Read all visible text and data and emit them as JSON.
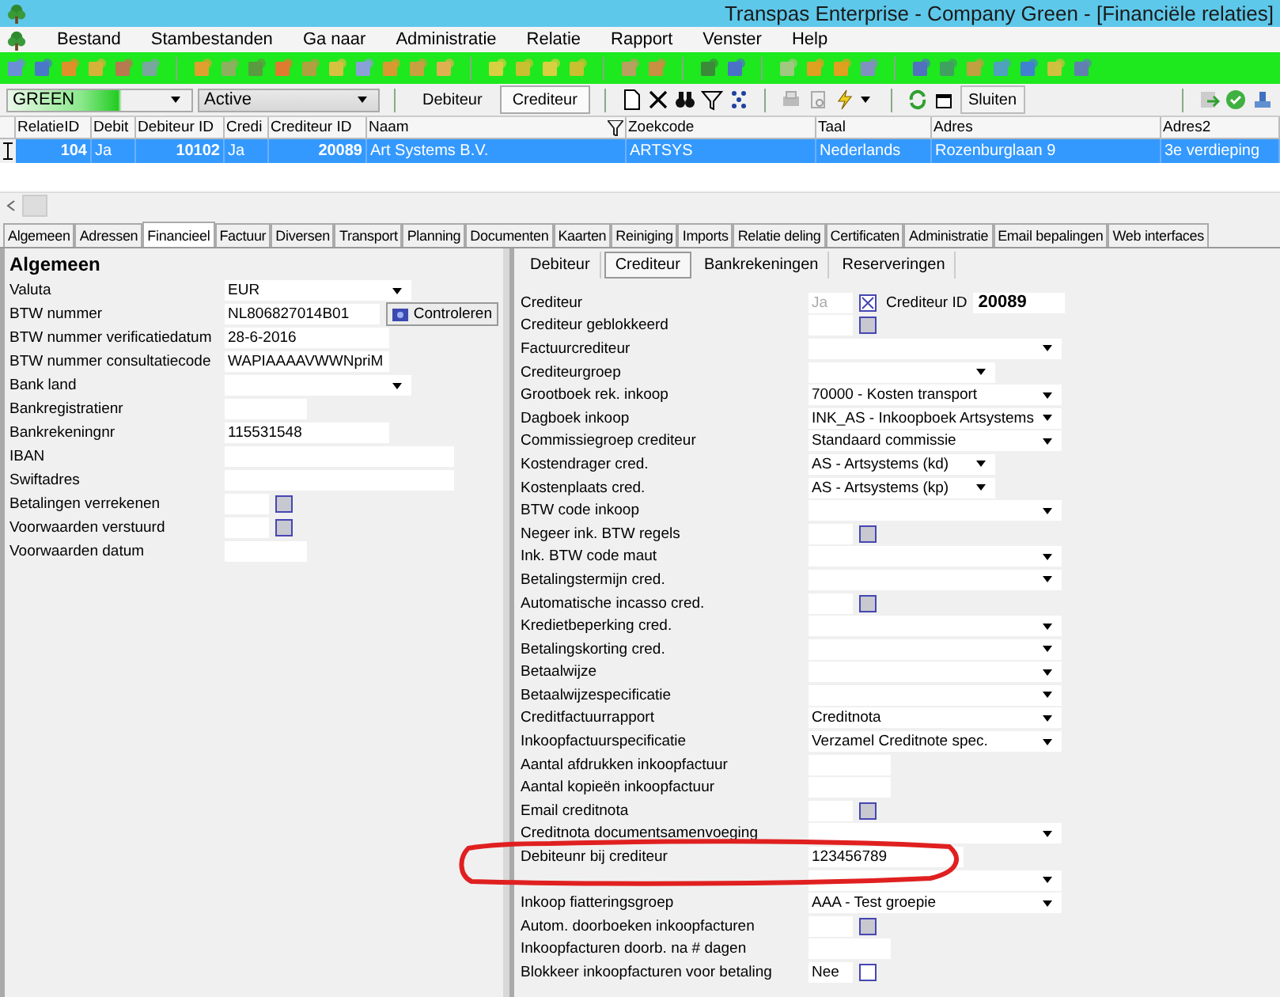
{
  "window": {
    "title": "Transpas Enterprise - Company Green - [Financiële relaties]"
  },
  "menu": [
    "Bestand",
    "Stambestanden",
    "Ga naar",
    "Administratie",
    "Relatie",
    "Rapport",
    "Venster",
    "Help"
  ],
  "filter_bar": {
    "company": "GREEN",
    "status": "Active",
    "modes": [
      {
        "label": "Debiteur",
        "selected": false
      },
      {
        "label": "Crediteur",
        "selected": true
      }
    ],
    "close_button": "Sluiten"
  },
  "grid": {
    "columns": [
      {
        "label": "RelatieID",
        "kind": "number",
        "filtered": false
      },
      {
        "label": "Debit",
        "kind": "text",
        "filtered": false
      },
      {
        "label": "Debiteur ID",
        "kind": "number",
        "filtered": false
      },
      {
        "label": "Credi",
        "kind": "text",
        "filtered": false
      },
      {
        "label": "Crediteur ID",
        "kind": "number",
        "filtered": false
      },
      {
        "label": "Naam",
        "kind": "text",
        "filtered": true
      },
      {
        "label": "Zoekcode",
        "kind": "text",
        "filtered": false
      },
      {
        "label": "Taal",
        "kind": "text",
        "filtered": false
      },
      {
        "label": "Adres",
        "kind": "text",
        "filtered": false
      },
      {
        "label": "Adres2",
        "kind": "text",
        "filtered": false
      }
    ],
    "rows": [
      {
        "selected": true,
        "cells": [
          "104",
          "Ja",
          "10102",
          "Ja",
          "20089",
          "Art Systems B.V.",
          "ARTSYS",
          "Nederlands",
          "Rozenburglaan 9",
          "3e verdieping"
        ]
      }
    ]
  },
  "tabs": [
    {
      "label": "Algemeen",
      "selected": false
    },
    {
      "label": "Adressen",
      "selected": false
    },
    {
      "label": "Financieel",
      "selected": true
    },
    {
      "label": "Factuur",
      "selected": false
    },
    {
      "label": "Diversen",
      "selected": false
    },
    {
      "label": "Transport",
      "selected": false
    },
    {
      "label": "Planning",
      "selected": false
    },
    {
      "label": "Documenten",
      "selected": false
    },
    {
      "label": "Kaarten",
      "selected": false
    },
    {
      "label": "Reiniging",
      "selected": false
    },
    {
      "label": "Imports",
      "selected": false
    },
    {
      "label": "Relatie deling",
      "selected": false
    },
    {
      "label": "Certificaten",
      "selected": false
    },
    {
      "label": "Administratie",
      "selected": false
    },
    {
      "label": "Email bepalingen",
      "selected": false
    },
    {
      "label": "Web interfaces",
      "selected": false
    }
  ],
  "left_panel": {
    "heading": "Algemeen",
    "fields": [
      {
        "label": "Valuta",
        "kind": "combo-short",
        "value": "EUR"
      },
      {
        "label": "BTW nummer",
        "kind": "text-button",
        "value": "NL806827014B01",
        "button": "Controleren"
      },
      {
        "label": "BTW nummer verificatiedatum",
        "kind": "text",
        "value": "28-6-2016"
      },
      {
        "label": "BTW nummer consultatiecode",
        "kind": "text",
        "value": "WAPIAAAAVWWNpriM"
      },
      {
        "label": "Bank land",
        "kind": "combo-short"
      },
      {
        "label": "Bankregistratienr",
        "kind": "text-short"
      },
      {
        "label": "Bankrekeningnr",
        "kind": "text",
        "value": "115531548"
      },
      {
        "label": "IBAN",
        "kind": "text-wide"
      },
      {
        "label": "Swiftadres",
        "kind": "text-wide"
      },
      {
        "label": "Betalingen verrekenen",
        "kind": "check",
        "checked": false,
        "indeterminate": true
      },
      {
        "label": "Voorwaarden verstuurd",
        "kind": "check",
        "checked": false,
        "indeterminate": true
      },
      {
        "label": "Voorwaarden datum",
        "kind": "text-short"
      }
    ]
  },
  "right_panel": {
    "subtabs": [
      {
        "label": "Debiteur",
        "selected": false
      },
      {
        "label": "Crediteur",
        "selected": true
      },
      {
        "label": "Bankrekeningen",
        "selected": false
      },
      {
        "label": "Reserveringen",
        "selected": false
      }
    ],
    "fields": [
      {
        "label": "Crediteur",
        "kind": "check-id",
        "value": "Ja",
        "checked": true,
        "indeterminate": false,
        "id_label": "Crediteur ID",
        "id": "20089"
      },
      {
        "label": "Crediteur geblokkeerd",
        "kind": "check",
        "checked": false,
        "indeterminate": true
      },
      {
        "label": "Factuurcrediteur",
        "kind": "combo-long"
      },
      {
        "label": "Crediteurgroep",
        "kind": "combo-short"
      },
      {
        "label": "Grootboek rek. inkoop",
        "kind": "combo-long",
        "value": "70000 - Kosten transport"
      },
      {
        "label": "Dagboek inkoop",
        "kind": "combo-long",
        "value": "INK_AS - Inkoopboek Artsystems"
      },
      {
        "label": "Commissiegroep crediteur",
        "kind": "combo-long",
        "value": "Standaard commissie"
      },
      {
        "label": "Kostendrager cred.",
        "kind": "combo-short",
        "value": "AS - Artsystems (kd)"
      },
      {
        "label": "Kostenplaats cred.",
        "kind": "combo-short",
        "value": "AS - Artsystems (kp)"
      },
      {
        "label": "BTW code inkoop",
        "kind": "combo-long"
      },
      {
        "label": "Negeer ink. BTW regels",
        "kind": "check",
        "checked": false,
        "indeterminate": true
      },
      {
        "label": "Ink. BTW code maut",
        "kind": "combo-long"
      },
      {
        "label": "Betalingstermijn cred.",
        "kind": "combo-long"
      },
      {
        "label": "Automatische incasso cred.",
        "kind": "check",
        "checked": false,
        "indeterminate": true
      },
      {
        "label": "Kredietbeperking cred.",
        "kind": "combo-long"
      },
      {
        "label": "Betalingskorting cred.",
        "kind": "combo-long"
      },
      {
        "label": "Betaalwijze",
        "kind": "combo-long"
      },
      {
        "label": "Betaalwijzespecificatie",
        "kind": "combo-long"
      },
      {
        "label": "Creditfactuurrapport",
        "kind": "combo-long",
        "value": "Creditnota"
      },
      {
        "label": "Inkoopfactuurspecificatie",
        "kind": "combo-long",
        "value": "Verzamel Creditnote spec."
      },
      {
        "label": "Aantal afdrukken inkoopfactuur",
        "kind": "text-short"
      },
      {
        "label": "Aantal kopieën inkoopfactuur",
        "kind": "text-short"
      },
      {
        "label": "Email creditnota",
        "kind": "check",
        "checked": false,
        "indeterminate": true
      },
      {
        "label": "Creditnota documentsamenvoeging",
        "kind": "combo-long"
      },
      {
        "label": "Debiteunr bij crediteur",
        "kind": "text-long",
        "value": "123456789"
      },
      {
        "kind": "combo-long"
      },
      {
        "label": "Inkoop fiatteringsgroep",
        "kind": "combo-long",
        "value": "AAA - Test groepie"
      },
      {
        "label": "Autom. doorboeken inkoopfacturen",
        "kind": "check",
        "checked": false,
        "indeterminate": true
      },
      {
        "label": "Inkoopfacturen doorb. na # dagen",
        "kind": "text-short"
      },
      {
        "label": "Blokkeer inkoopfacturen voor betaling",
        "kind": "check",
        "value": "Nee",
        "checked": false,
        "indeterminate": false
      }
    ]
  }
}
